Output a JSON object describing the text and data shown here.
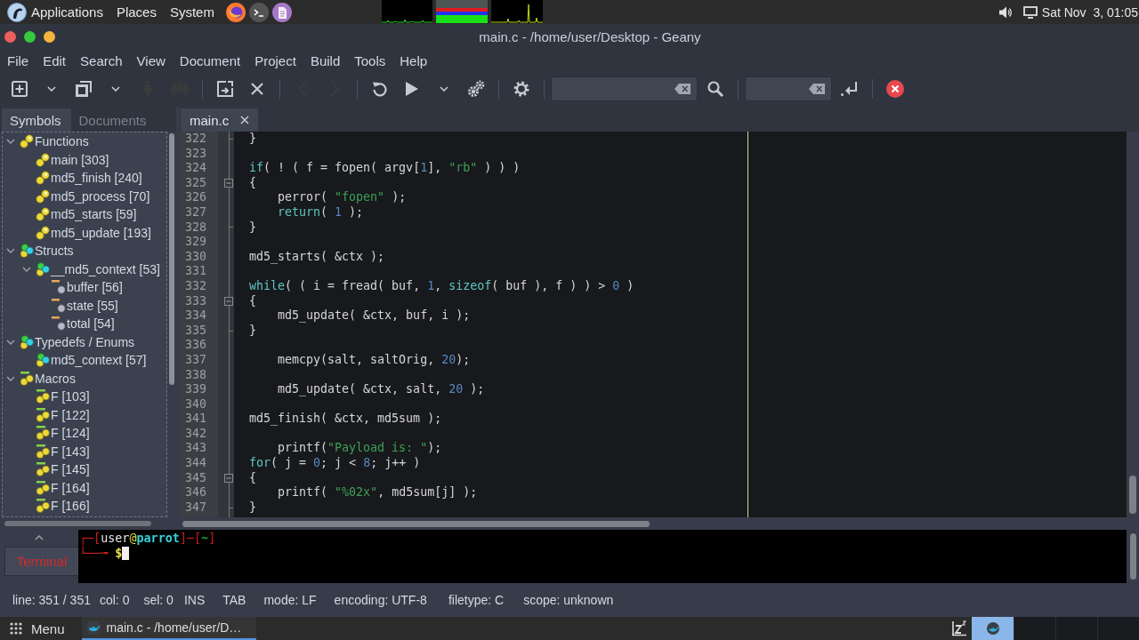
{
  "top_panel": {
    "menus": [
      "Applications",
      "Places",
      "System"
    ],
    "clock": "Sat Nov  3, 01:05"
  },
  "window": {
    "title": "main.c - /home/user/Desktop - Geany"
  },
  "menu_bar": [
    "File",
    "Edit",
    "Search",
    "View",
    "Document",
    "Project",
    "Build",
    "Tools",
    "Help"
  ],
  "toolbar": [
    {
      "kind": "button",
      "disabled": false
    },
    {
      "kind": "menu",
      "disabled": false
    },
    {
      "kind": "button",
      "disabled": false
    },
    {
      "kind": "menu",
      "disabled": false
    },
    {
      "kind": "button",
      "disabled": true
    },
    {
      "kind": "button",
      "disabled": true
    },
    {
      "kind": "separator"
    },
    {
      "kind": "button",
      "disabled": false
    },
    {
      "kind": "button",
      "disabled": false
    },
    {
      "kind": "separator"
    },
    {
      "kind": "button",
      "disabled": true
    },
    {
      "kind": "button",
      "disabled": true
    },
    {
      "kind": "separator"
    },
    {
      "kind": "button",
      "disabled": false
    },
    {
      "kind": "button",
      "disabled": false
    },
    {
      "kind": "menu",
      "disabled": false
    },
    {
      "kind": "button",
      "disabled": false
    },
    {
      "kind": "separator"
    },
    {
      "kind": "button",
      "disabled": false
    },
    {
      "kind": "separator"
    },
    {
      "kind": "field"
    },
    {
      "kind": "button",
      "disabled": false
    },
    {
      "kind": "separator"
    },
    {
      "kind": "field"
    },
    {
      "kind": "button",
      "disabled": false
    },
    {
      "kind": "separator"
    },
    {
      "kind": "button",
      "disabled": false
    }
  ],
  "sidebar": {
    "tabs": [
      {
        "label": "Symbols",
        "selected": true
      },
      {
        "label": "Documents",
        "selected": false
      }
    ],
    "tree": [
      {
        "label": "Functions",
        "kind": "function",
        "expanded": true,
        "children": [
          {
            "label": "main [303]",
            "kind": "function"
          },
          {
            "label": "md5_finish [240]",
            "kind": "function"
          },
          {
            "label": "md5_process [70]",
            "kind": "function"
          },
          {
            "label": "md5_starts [59]",
            "kind": "function"
          },
          {
            "label": "md5_update [193]",
            "kind": "function"
          }
        ]
      },
      {
        "label": "Structs",
        "kind": "struct",
        "expanded": true,
        "children": [
          {
            "label": "__md5_context [53]",
            "kind": "struct",
            "expanded": true,
            "children": [
              {
                "label": "buffer [56]",
                "kind": "member"
              },
              {
                "label": "state [55]",
                "kind": "member"
              },
              {
                "label": "total [54]",
                "kind": "member"
              }
            ]
          }
        ]
      },
      {
        "label": "Typedefs / Enums",
        "kind": "struct",
        "expanded": true,
        "children": [
          {
            "label": "md5_context [57]",
            "kind": "struct"
          }
        ]
      },
      {
        "label": "Macros",
        "kind": "macro",
        "expanded": true,
        "children": [
          {
            "label": "F [103]",
            "kind": "macro"
          },
          {
            "label": "F [122]",
            "kind": "macro"
          },
          {
            "label": "F [124]",
            "kind": "macro"
          },
          {
            "label": "F [143]",
            "kind": "macro"
          },
          {
            "label": "F [145]",
            "kind": "macro"
          },
          {
            "label": "F [164]",
            "kind": "macro"
          },
          {
            "label": "F [166]",
            "kind": "macro"
          }
        ]
      }
    ]
  },
  "editor": {
    "tabs": [
      {
        "label": "main.c",
        "selected": true
      }
    ],
    "lines": [
      {
        "number": "322",
        "kind": "end",
        "tokens": [
          {
            "kind": "plain",
            "text": "}"
          }
        ]
      },
      {
        "number": "323",
        "kind": "plain"
      },
      {
        "number": "324",
        "kind": "plain",
        "tokens": [
          {
            "kind": "keyword",
            "text": "if"
          },
          {
            "kind": "plain",
            "text": "( ! ( f = fopen( argv["
          },
          {
            "kind": "number",
            "text": "1"
          },
          {
            "kind": "plain",
            "text": "], "
          },
          {
            "kind": "string",
            "text": "\"rb\""
          },
          {
            "kind": "plain",
            "text": " ) ) )"
          }
        ]
      },
      {
        "number": "325",
        "kind": "start",
        "expanded": true,
        "tokens": [
          {
            "kind": "plain",
            "text": "{"
          }
        ]
      },
      {
        "number": "326",
        "kind": "plain",
        "tokens": [
          {
            "kind": "plain",
            "text": "    perror( "
          },
          {
            "kind": "string",
            "text": "\"fopen\""
          },
          {
            "kind": "plain",
            "text": " );"
          }
        ]
      },
      {
        "number": "327",
        "kind": "plain",
        "tokens": [
          {
            "kind": "keyword",
            "text": "    return"
          },
          {
            "kind": "plain",
            "text": "( "
          },
          {
            "kind": "number",
            "text": "1"
          },
          {
            "kind": "plain",
            "text": " );"
          }
        ]
      },
      {
        "number": "328",
        "kind": "end",
        "tokens": [
          {
            "kind": "plain",
            "text": "}"
          }
        ]
      },
      {
        "number": "329",
        "kind": "plain"
      },
      {
        "number": "330",
        "kind": "plain",
        "tokens": [
          {
            "kind": "plain",
            "text": "md5_starts( &ctx );"
          }
        ]
      },
      {
        "number": "331",
        "kind": "plain"
      },
      {
        "number": "332",
        "kind": "plain",
        "tokens": [
          {
            "kind": "keyword",
            "text": "while"
          },
          {
            "kind": "plain",
            "text": "( ( i = fread( buf, "
          },
          {
            "kind": "number",
            "text": "1"
          },
          {
            "kind": "plain",
            "text": ", "
          },
          {
            "kind": "keyword",
            "text": "sizeof"
          },
          {
            "kind": "plain",
            "text": "( buf ), f ) ) > "
          },
          {
            "kind": "number",
            "text": "0"
          },
          {
            "kind": "plain",
            "text": " )"
          }
        ]
      },
      {
        "number": "333",
        "kind": "start",
        "expanded": true,
        "tokens": [
          {
            "kind": "plain",
            "text": "{"
          }
        ]
      },
      {
        "number": "334",
        "kind": "plain",
        "tokens": [
          {
            "kind": "plain",
            "text": "    md5_update( &ctx, buf, i );"
          }
        ]
      },
      {
        "number": "335",
        "kind": "end",
        "tokens": [
          {
            "kind": "plain",
            "text": "}"
          }
        ]
      },
      {
        "number": "336",
        "kind": "plain"
      },
      {
        "number": "337",
        "kind": "plain",
        "tokens": [
          {
            "kind": "plain",
            "text": "    memcpy(salt, saltOrig, "
          },
          {
            "kind": "number",
            "text": "20"
          },
          {
            "kind": "plain",
            "text": ");"
          }
        ]
      },
      {
        "number": "338",
        "kind": "plain"
      },
      {
        "number": "339",
        "kind": "plain",
        "tokens": [
          {
            "kind": "plain",
            "text": "    md5_update( &ctx, salt, "
          },
          {
            "kind": "number",
            "text": "20"
          },
          {
            "kind": "plain",
            "text": " );"
          }
        ]
      },
      {
        "number": "340",
        "kind": "plain"
      },
      {
        "number": "341",
        "kind": "plain",
        "tokens": [
          {
            "kind": "plain",
            "text": "md5_finish( &ctx, md5sum );"
          }
        ]
      },
      {
        "number": "342",
        "kind": "plain"
      },
      {
        "number": "343",
        "kind": "plain",
        "tokens": [
          {
            "kind": "plain",
            "text": "    printf("
          },
          {
            "kind": "string",
            "text": "\"Payload is: \""
          },
          {
            "kind": "plain",
            "text": ");"
          }
        ]
      },
      {
        "number": "344",
        "kind": "plain",
        "tokens": [
          {
            "kind": "keyword",
            "text": "for"
          },
          {
            "kind": "plain",
            "text": "( j = "
          },
          {
            "kind": "number",
            "text": "0"
          },
          {
            "kind": "plain",
            "text": "; j < "
          },
          {
            "kind": "number",
            "text": "8"
          },
          {
            "kind": "plain",
            "text": "; j++ )"
          }
        ]
      },
      {
        "number": "345",
        "kind": "start",
        "expanded": true,
        "tokens": [
          {
            "kind": "plain",
            "text": "{"
          }
        ]
      },
      {
        "number": "346",
        "kind": "plain",
        "tokens": [
          {
            "kind": "plain",
            "text": "    printf( "
          },
          {
            "kind": "string",
            "text": "\"%02x\""
          },
          {
            "kind": "plain",
            "text": ", md5sum[j] );"
          }
        ]
      },
      {
        "number": "347",
        "kind": "end",
        "tokens": [
          {
            "kind": "plain",
            "text": "}"
          }
        ]
      }
    ]
  },
  "message_window": {
    "tabs": [
      {
        "label": "Terminal",
        "selected": true,
        "alert": true
      }
    ],
    "terminal": {
      "lines": [
        {
          "segments": [
            {
              "text": "┌─[",
              "color": "#cc1f1f"
            },
            {
              "text": "user",
              "color": "#e8e8e8"
            },
            {
              "text": "@",
              "color": "#e6e04a"
            },
            {
              "text": "**parrot**",
              "color": "#34d2d8"
            },
            {
              "text": "]─[",
              "color": "#cc1f1f"
            },
            {
              "text": "~",
              "color": "#2eb84a"
            },
            {
              "text": "]",
              "color": "#cc1f1f"
            }
          ]
        },
        {
          "segments": [
            {
              "text": "└──╼ ",
              "color": "#cc1f1f"
            },
            {
              "text": "**$**",
              "color": "#ece24a"
            }
          ]
        }
      ]
    }
  },
  "status_bar": [
    "line: 351 / 351",
    "col: 0",
    "sel: 0",
    "INS",
    "TAB",
    "mode: LF",
    "encoding: UTF-8",
    "filetype: C",
    "scope: unknown"
  ],
  "taskbar": {
    "menu": "Menu",
    "tasks": [
      {
        "label": "main.c - /home/user/D…",
        "selected": true
      }
    ],
    "workspaces": [
      {
        "selected": true
      },
      {
        "selected": false
      },
      {
        "selected": false
      },
      {
        "selected": false
      }
    ]
  }
}
